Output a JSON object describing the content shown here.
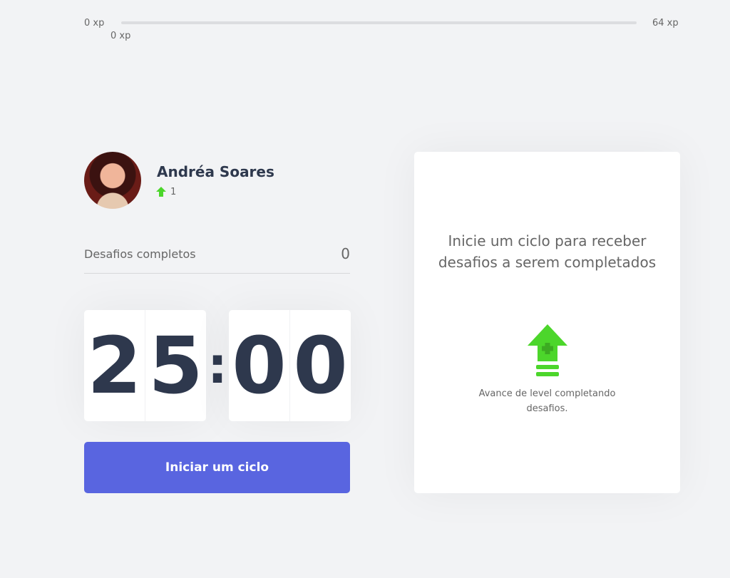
{
  "xp": {
    "min_label": "0 xp",
    "current_label": "0 xp",
    "max_label": "64 xp",
    "progress_fraction": 0
  },
  "profile": {
    "name": "Andréa Soares",
    "level": "1"
  },
  "challenges": {
    "label": "Desafios completos",
    "value": "0"
  },
  "countdown": {
    "minute_left": "2",
    "minute_right": "5",
    "separator": ":",
    "second_left": "0",
    "second_right": "0"
  },
  "start_button": {
    "label": "Iniciar um ciclo"
  },
  "challenge_box": {
    "title": "Inicie um ciclo para receber desafios a serem completados",
    "hint": "Avance de level completando desafios."
  },
  "colors": {
    "accent": "#5965e0",
    "level_green": "#4cd62b",
    "title_text": "#2e384d",
    "body_text": "#666666",
    "background": "#f2f3f5"
  },
  "icons": {
    "level": "level-up-arrow-icon",
    "challenge": "level-up-icon"
  }
}
